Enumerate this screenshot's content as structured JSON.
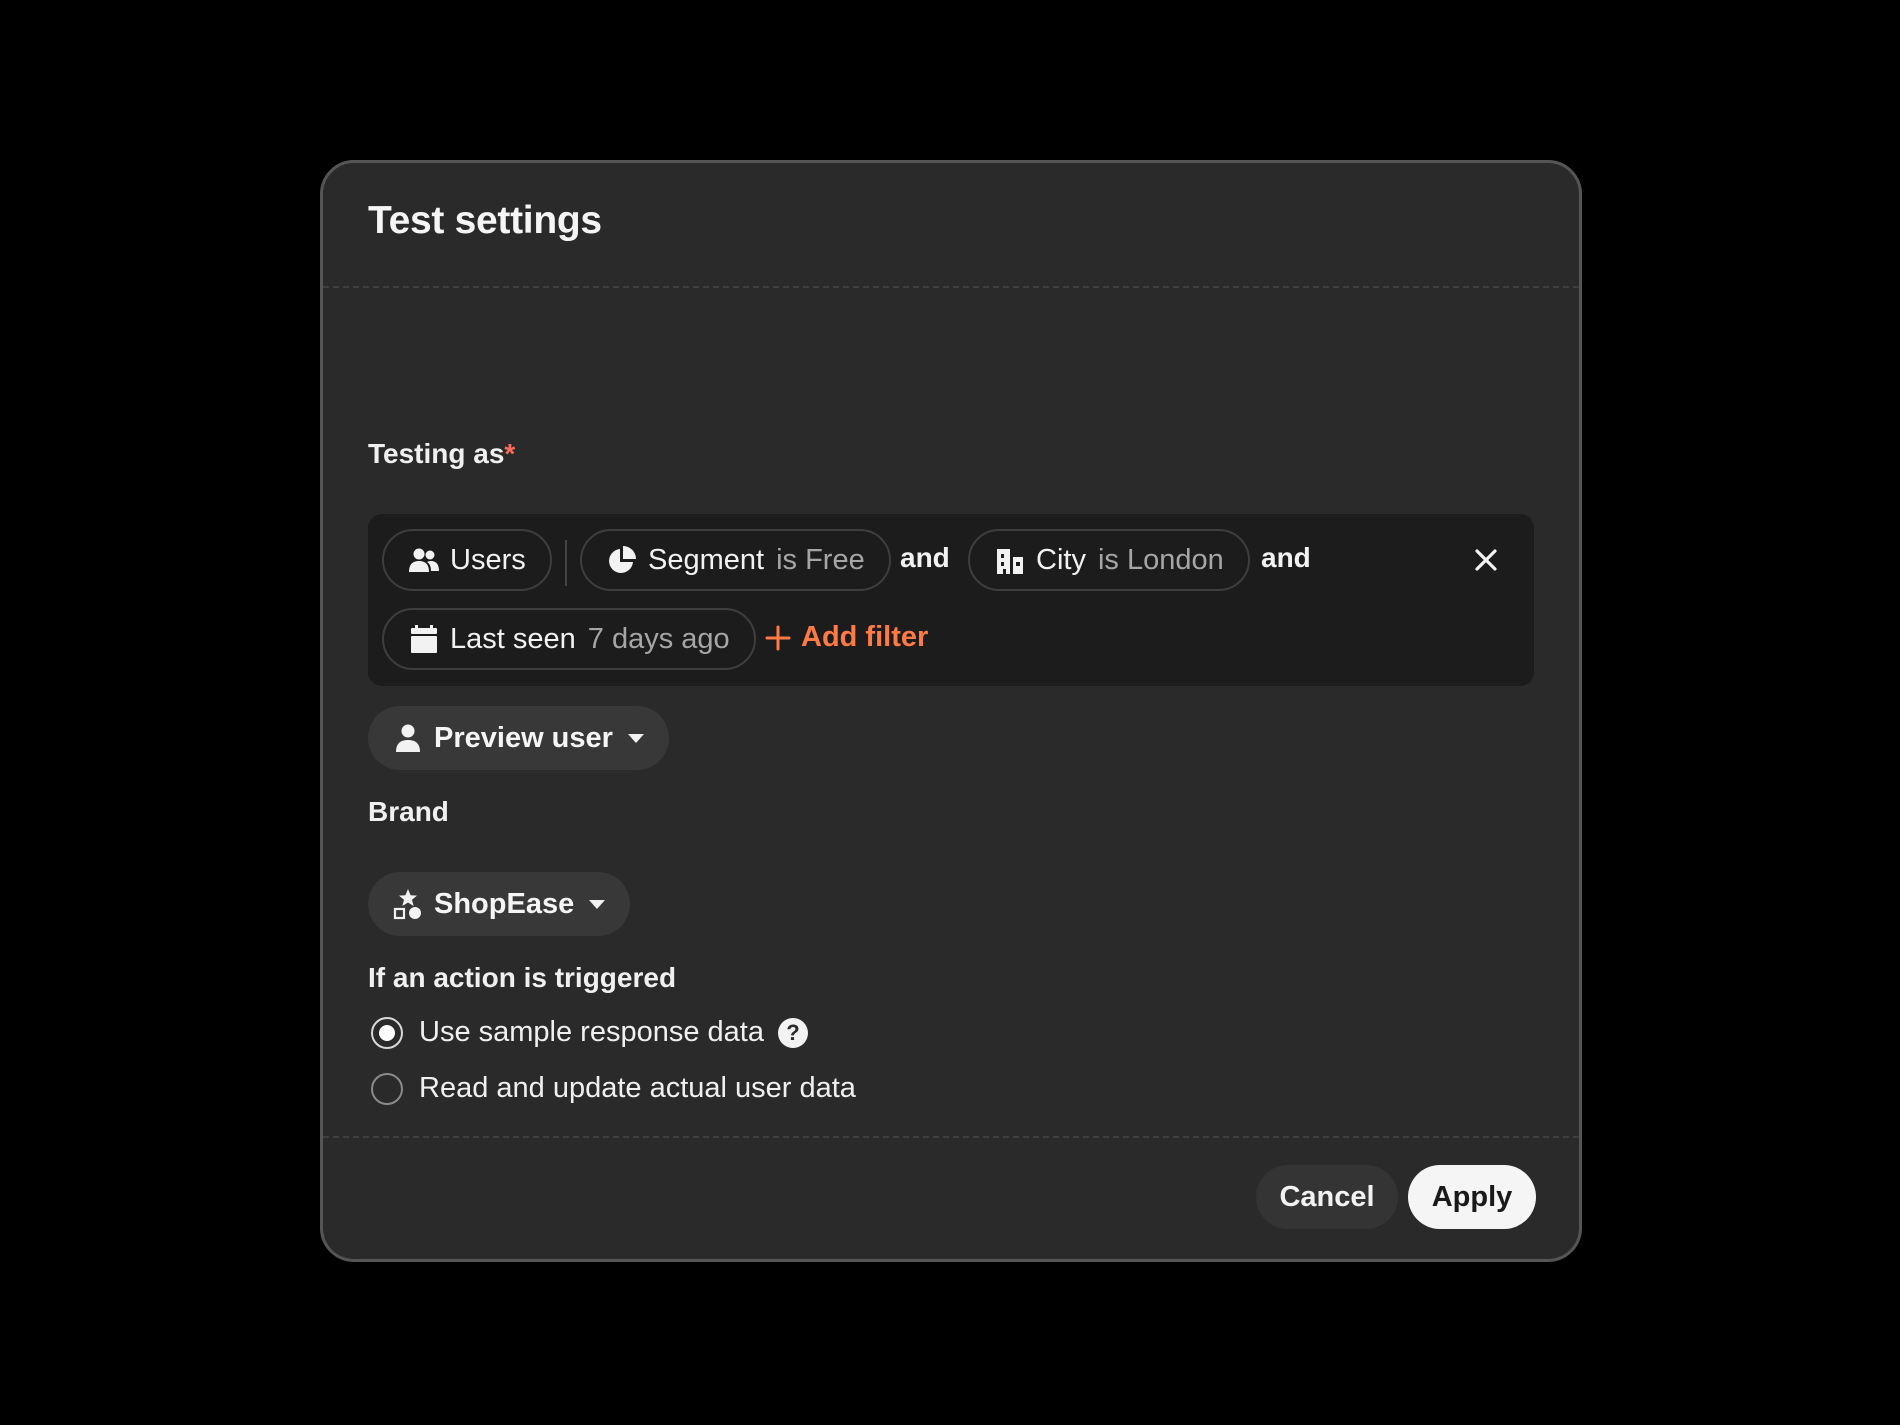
{
  "dialog": {
    "title": "Test settings"
  },
  "testing_as": {
    "label": "Testing as",
    "required_mark": "*",
    "audience_pill": {
      "label": "Users",
      "icon": "users-icon"
    },
    "filters": [
      {
        "field": "Segment",
        "operator_value": "is Free",
        "icon": "pie-chart-icon"
      },
      {
        "field": "City",
        "operator_value": "is London",
        "icon": "building-icon"
      },
      {
        "field": "Last seen",
        "operator_value": "7 days ago",
        "icon": "calendar-icon"
      }
    ],
    "conjunctions": [
      "and",
      "and"
    ],
    "add_filter_label": "Add filter",
    "clear_icon": "close-icon"
  },
  "preview_user": {
    "label": "Preview user",
    "icon": "person-icon"
  },
  "brand": {
    "label": "Brand",
    "selected": "ShopEase",
    "icon": "shapes-icon"
  },
  "action": {
    "label": "If an action is triggered",
    "options": [
      {
        "label": "Use sample response data",
        "selected": true,
        "help_icon": "question-icon",
        "help_glyph": "?"
      },
      {
        "label": "Read and update actual user data",
        "selected": false
      }
    ]
  },
  "footer": {
    "cancel_label": "Cancel",
    "apply_label": "Apply"
  },
  "colors": {
    "background": "#000000",
    "modal": "#2a2a2a",
    "filter_box": "#1c1c1c",
    "accent": "#ff7a45",
    "required": "#ff6b5b"
  }
}
